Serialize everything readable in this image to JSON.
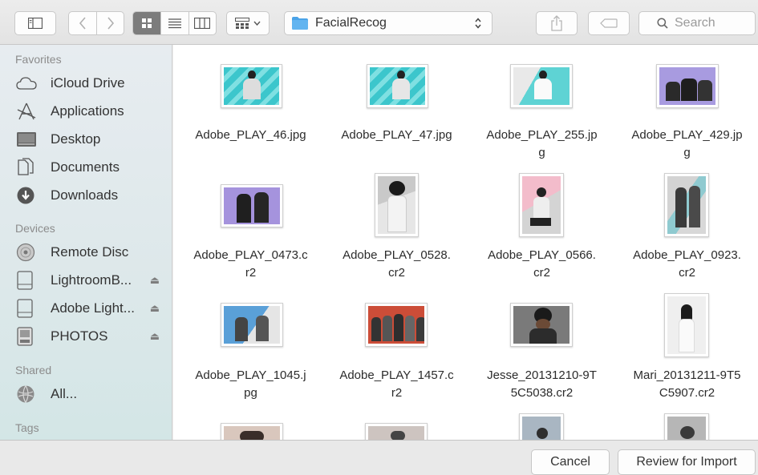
{
  "toolbar": {
    "path_folder": "FacialRecog",
    "search_placeholder": "Search"
  },
  "sidebar": {
    "favorites_header": "Favorites",
    "favorites": [
      {
        "label": "iCloud Drive",
        "icon": "cloud-icon"
      },
      {
        "label": "Applications",
        "icon": "applications-icon"
      },
      {
        "label": "Desktop",
        "icon": "desktop-icon"
      },
      {
        "label": "Documents",
        "icon": "documents-icon"
      },
      {
        "label": "Downloads",
        "icon": "downloads-icon"
      }
    ],
    "devices_header": "Devices",
    "devices": [
      {
        "label": "Remote Disc",
        "icon": "disc-icon",
        "eject": false
      },
      {
        "label": "LightroomB...",
        "icon": "drive-icon",
        "eject": true
      },
      {
        "label": "Adobe Light...",
        "icon": "drive-icon",
        "eject": true
      },
      {
        "label": "PHOTOS",
        "icon": "sdcard-icon",
        "eject": true
      }
    ],
    "shared_header": "Shared",
    "shared": [
      {
        "label": "All...",
        "icon": "network-icon"
      }
    ],
    "tags_header": "Tags"
  },
  "files": [
    {
      "line1": "Adobe_PLAY_46.jpg",
      "line2": ""
    },
    {
      "line1": "Adobe_PLAY_47.jpg",
      "line2": ""
    },
    {
      "line1": "Adobe_PLAY_255.jp",
      "line2": "g"
    },
    {
      "line1": "Adobe_PLAY_429.jp",
      "line2": "g"
    },
    {
      "line1": "Adobe_PLAY_0473.c",
      "line2": "r2"
    },
    {
      "line1": "Adobe_PLAY_0528.",
      "line2": "cr2"
    },
    {
      "line1": "Adobe_PLAY_0566.",
      "line2": "cr2"
    },
    {
      "line1": "Adobe_PLAY_0923.",
      "line2": "cr2"
    },
    {
      "line1": "Adobe_PLAY_1045.j",
      "line2": "pg"
    },
    {
      "line1": "Adobe_PLAY_1457.c",
      "line2": "r2"
    },
    {
      "line1": "Jesse_20131210-9T",
      "line2": "5C5038.cr2"
    },
    {
      "line1": "Mari_20131211-9T5",
      "line2": "C5907.cr2"
    }
  ],
  "buttons": {
    "cancel": "Cancel",
    "review": "Review for Import"
  },
  "colors": {
    "folder_blue": "#4aa3e8",
    "teal_bg": "#4ecfd2",
    "lavender_bg": "#a89be0",
    "pink_bg": "#f2b8c8"
  }
}
